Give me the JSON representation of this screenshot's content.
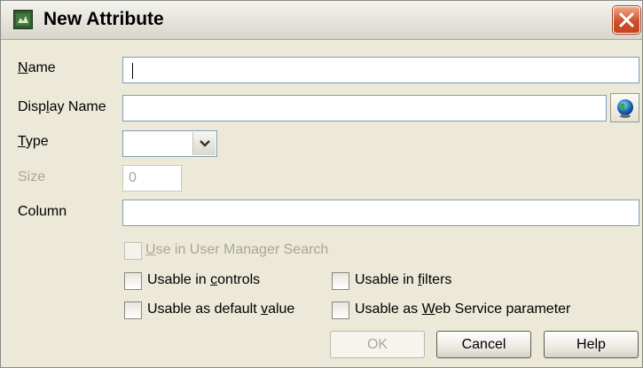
{
  "window": {
    "title": "New Attribute",
    "close_glyph": "close-icon"
  },
  "form": {
    "name": {
      "label_u": "N",
      "label_rest": "ame",
      "value": ""
    },
    "display_name": {
      "label_pre": "Disp",
      "label_u": "l",
      "label_rest": "ay Name",
      "value": ""
    },
    "type": {
      "label_u": "T",
      "label_rest": "ype",
      "value": ""
    },
    "size": {
      "label": "Size",
      "value": "0"
    },
    "column": {
      "label": "Column",
      "value": ""
    }
  },
  "options": {
    "use_in_user_manager_search": {
      "label_u": "U",
      "label_rest": "se in User Manager Search",
      "checked": false,
      "enabled": false
    },
    "usable_in_controls": {
      "label_pre": "Usable in ",
      "label_u": "c",
      "label_rest": "ontrols",
      "checked": false
    },
    "usable_in_filters": {
      "label_pre": "Usable in ",
      "label_u": "f",
      "label_rest": "ilters",
      "checked": false
    },
    "usable_as_default_value": {
      "label_pre": "Usable as default ",
      "label_u": "v",
      "label_rest": "alue",
      "checked": false
    },
    "usable_as_web_service_parameter": {
      "label_pre": "Usable as ",
      "label_u": "W",
      "label_rest": "eb Service parameter",
      "checked": false
    }
  },
  "buttons": {
    "ok": "OK",
    "cancel": "Cancel",
    "help": "Help"
  },
  "colors": {
    "dialog_bg": "#ece9d8",
    "field_border": "#7f9db9",
    "close_red": "#d0502c",
    "disabled_text": "#a8a698"
  }
}
